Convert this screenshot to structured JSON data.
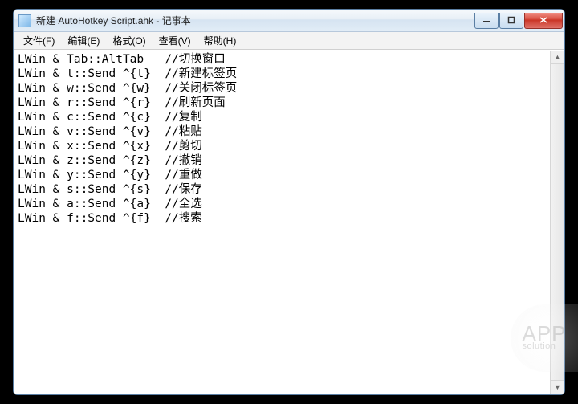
{
  "title": "新建 AutoHotkey Script.ahk - 记事本",
  "menu": {
    "file": "文件(F)",
    "edit": "编辑(E)",
    "format": "格式(O)",
    "view": "查看(V)",
    "help": "帮助(H)"
  },
  "body_text": "LWin & Tab::AltTab   //切换窗口\nLWin & t::Send ^{t}  //新建标签页\nLWin & w::Send ^{w}  //关闭标签页\nLWin & r::Send ^{r}  //刷新页面\nLWin & c::Send ^{c}  //复制\nLWin & v::Send ^{v}  //粘贴\nLWin & x::Send ^{x}  //剪切\nLWin & z::Send ^{z}  //撤销\nLWin & y::Send ^{y}  //重做\nLWin & s::Send ^{s}  //保存\nLWin & a::Send ^{a}  //全选\nLWin & f::Send ^{f}  //搜索",
  "watermark": {
    "line1": "APP",
    "line2": "solution"
  }
}
